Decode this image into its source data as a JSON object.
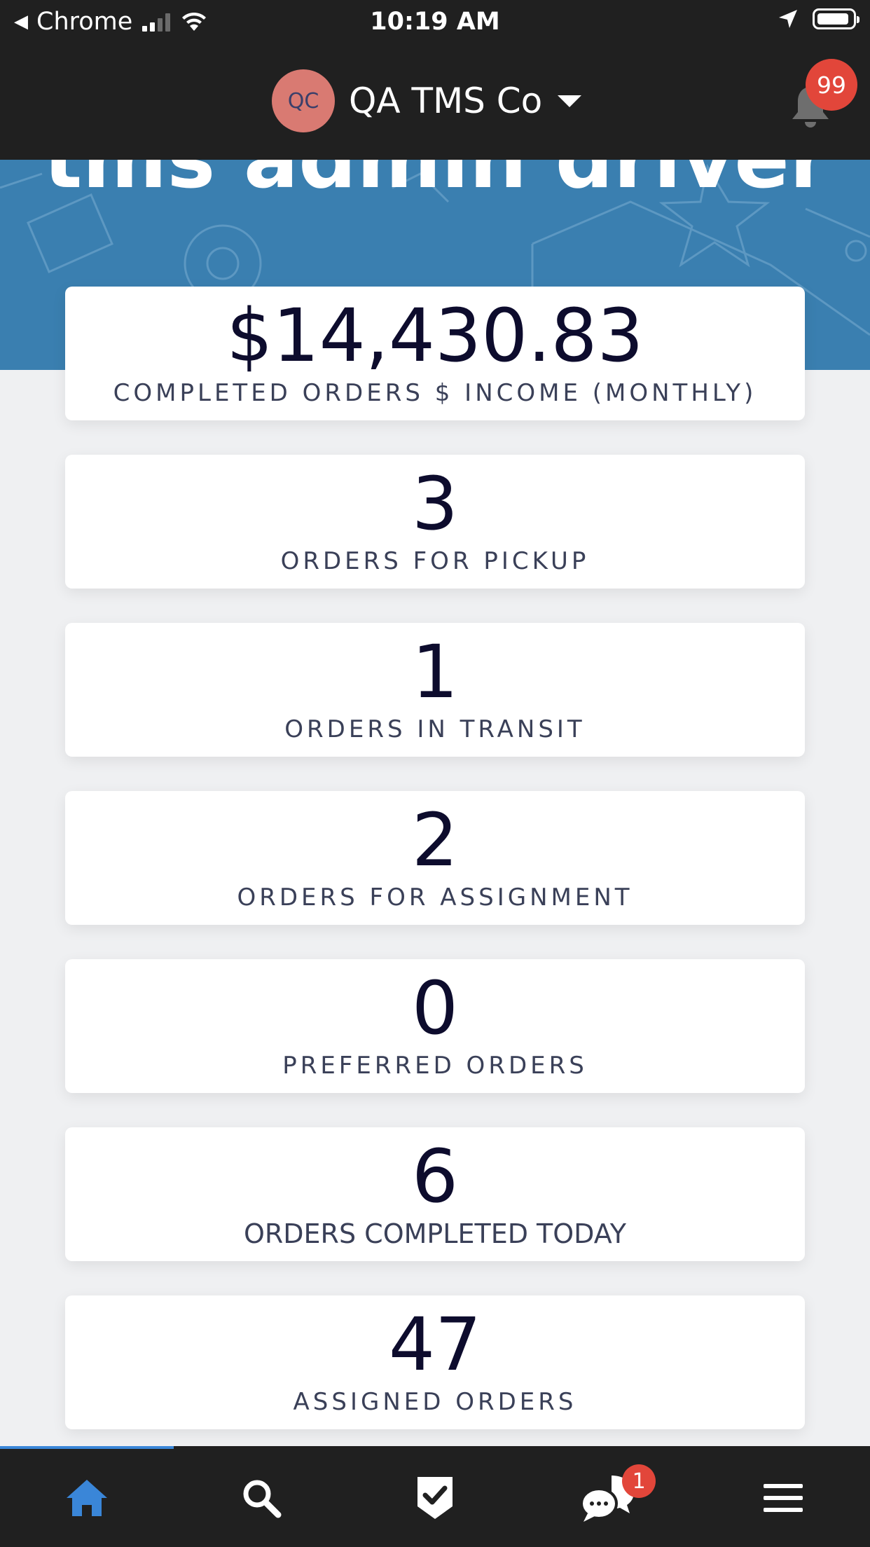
{
  "status_bar": {
    "back_app": "Chrome",
    "time": "10:19 AM"
  },
  "header": {
    "avatar_initials": "QC",
    "company_name": "QA TMS Co",
    "notification_count": "99"
  },
  "hero": {
    "title": "tms admin driver"
  },
  "stats": [
    {
      "value": "$14,430.83",
      "label": "COMPLETED ORDERS $ INCOME (MONTHLY)"
    },
    {
      "value": "3",
      "label": "ORDERS FOR PICKUP"
    },
    {
      "value": "1",
      "label": "ORDERS IN TRANSIT"
    },
    {
      "value": "2",
      "label": "ORDERS FOR ASSIGNMENT"
    },
    {
      "value": "0",
      "label": "PREFERRED ORDERS"
    },
    {
      "value": "6",
      "label": "ORDERS COMPLETED TODAY"
    },
    {
      "value": "47",
      "label": "ASSIGNED ORDERS"
    }
  ],
  "bottom_nav": {
    "items": [
      {
        "icon": "home-icon",
        "active": true
      },
      {
        "icon": "search-icon",
        "active": false
      },
      {
        "icon": "checklist-icon",
        "active": false
      },
      {
        "icon": "chat-icon",
        "active": false,
        "badge": "1"
      },
      {
        "icon": "menu-icon",
        "active": false
      }
    ],
    "active_color": "#3a86d8"
  },
  "colors": {
    "bar_background": "#202020",
    "hero_blue": "#3a7fb0",
    "badge_red": "#e2463a",
    "avatar": "#d97a72"
  }
}
